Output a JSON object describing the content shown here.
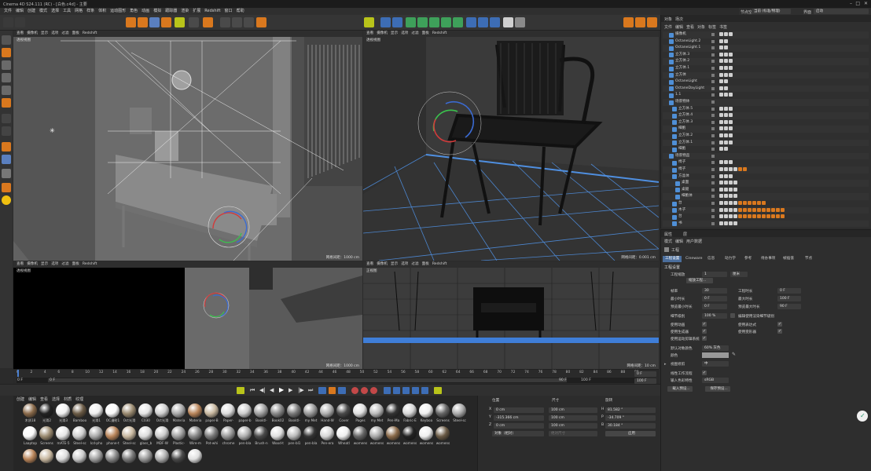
{
  "window": {
    "title": "Cinema 4D S24.111 (RC) - [白色.c4d] - 主要"
  },
  "menu": [
    "文件",
    "编辑",
    "创建",
    "模式",
    "选择",
    "工具",
    "网格",
    "样条",
    "体积",
    "运动图形",
    "角色",
    "动画",
    "模拟",
    "跟踪器",
    "渲染",
    "扩展",
    "Redshift",
    "窗口",
    "帮助"
  ],
  "viewports": {
    "menu_items": [
      "查看",
      "摄像机",
      "显示",
      "选项",
      "过滤",
      "面板",
      "Redshift"
    ],
    "tl": {
      "label": "透视视图",
      "grid": "网格间距：1000 cm"
    },
    "tr": {
      "label": "透视视图",
      "grid": "网格间距：0.001 cm"
    },
    "bl": {
      "label": "透视视图",
      "grid": "网格间距：1000 cm"
    },
    "br": {
      "label": "正视图",
      "grid": "网格间距：10 cm"
    }
  },
  "timeline": {
    "ticks": [
      "0",
      "2",
      "4",
      "6",
      "8",
      "10",
      "12",
      "14",
      "16",
      "18",
      "20",
      "22",
      "24",
      "26",
      "28",
      "30",
      "32",
      "34",
      "36",
      "38",
      "40",
      "42",
      "44",
      "46",
      "48",
      "50",
      "52",
      "54",
      "56",
      "58",
      "60",
      "62",
      "64",
      "66",
      "68",
      "70",
      "72",
      "74",
      "76",
      "78",
      "80",
      "82",
      "84",
      "86",
      "88",
      "90"
    ],
    "current": "0 F",
    "start": "0 F",
    "end": "90 F",
    "end2": "100 F",
    "right_a": "0 F",
    "right_b": "100 F"
  },
  "materials": {
    "menu": [
      "创建",
      "编辑",
      "查看",
      "选择",
      "材质",
      "纹理"
    ],
    "row1": [
      "木质18",
      "光滑2",
      "光滑3",
      "Bamboo",
      "光滑1",
      "OC漫射1",
      "Oct光滑",
      "C030",
      "Oct光滑",
      "Materia",
      "Materia",
      "paper-B",
      "Paper-",
      "paper-b",
      "Booktl-",
      "Book02",
      "Booktl-",
      "my Met",
      "Hand-W",
      "Cover",
      "Pages",
      "my Met",
      "Pen-Ma",
      "Fabric-E",
      "Keyboa",
      "Screens",
      "Steel-sc"
    ],
    "row2": [
      "Laaptop",
      "Screens",
      "mATE-5",
      "Steel-sc",
      "Icd-pho",
      "phone-t",
      "Steel-sc",
      "glass_b",
      "MDF-W",
      "Plastic-",
      "Wire-m",
      "Pot-whi",
      "chrome",
      "pen-bla",
      "Brush-n",
      "Wood-t",
      "pen-bl1",
      "pen-bla",
      "Pen-era",
      "Wheatl",
      "womens",
      "womens",
      "womens",
      "womens",
      "womens",
      "womens"
    ],
    "row3": [
      "",
      "",
      "",
      "",
      "",
      "",
      "",
      "",
      "",
      "",
      ""
    ]
  },
  "coords": {
    "headers": [
      "位置",
      "尺寸",
      "旋转"
    ],
    "x": {
      "label": "X",
      "pos": "0 cm",
      "size": "100 cm",
      "rot_label": "H",
      "rot": "81.582 °"
    },
    "y": {
      "label": "Y",
      "pos": "-315.366 cm",
      "size": "100 cm",
      "rot_label": "P",
      "rot": "-34.709 °"
    },
    "z": {
      "label": "Z",
      "pos": "0 cm",
      "size": "100 cm",
      "rot_label": "B",
      "rot": "30.184 °"
    },
    "mode": "对象（相对）",
    "size_mode": "绝对尺寸",
    "apply": "应用"
  },
  "objects": {
    "tabs": [
      "对象",
      "场次"
    ],
    "menu": [
      "文件",
      "编辑",
      "查看",
      "对象",
      "标签",
      "书签"
    ],
    "top_right": {
      "node_space": "节点空间",
      "node_value": "当前 (标准/物理)",
      "layout_label": "界面",
      "layout_value": "启动"
    },
    "items": [
      "摄像机",
      "OctaneLight.2",
      "OctaneLight.1",
      "立方体.3",
      "立方体.2",
      "立方体.1",
      "立方体",
      "OctaneLight",
      "OctaneDayLight",
      "1.1",
      "场景物体",
      "立方体.5",
      "立方体.4",
      "立方体.3",
      "细胞",
      "立方体.2",
      "立方体.1",
      "细胞",
      "场景物品",
      "椅子",
      "椅子",
      "方晶体",
      "桌面",
      "桌腿",
      "细胞体",
      "台",
      "木子",
      "台",
      "书"
    ]
  },
  "attributes": {
    "tabs": [
      "属性",
      "层"
    ],
    "menu": [
      "模式",
      "编辑",
      "用户数据"
    ],
    "title": "工程",
    "subtabs": [
      "工程设置",
      "Cineware",
      "信息",
      "动力学",
      "参考",
      "待办事项",
      "帧插值",
      "节点"
    ],
    "section": "工程设置",
    "scale_label": "工程缩放",
    "scale_value": "1",
    "scale_unit": "厘米",
    "scale_btn": "缩放工程...",
    "fps_label": "帧率",
    "fps_value": "30",
    "project_time_label": "工程时长",
    "project_time_value": "0 F",
    "min_time_label": "最小时长",
    "min_time_value": "0 F",
    "max_time_label": "最大时长",
    "max_time_value": "100 F",
    "preview_min_label": "预览最小时长",
    "preview_min_value": "0 F",
    "preview_max_label": "预览最大时长",
    "preview_max_value": "90 F",
    "lod_label": "细节级别",
    "lod_value": "100 %",
    "lod_render_label": "编辑使用渲染细节级别",
    "use_anim_label": "使用动画",
    "use_expr_label": "使用表达式",
    "use_gen_label": "使用生成器",
    "use_deform_label": "使用变形器",
    "use_motion_label": "使用运动剪辑系统",
    "def_color_label": "默认对象颜色",
    "def_color_value": "60% 灰色",
    "color_label": "颜色",
    "view_clip_label": "视图修剪",
    "view_clip_value": "中",
    "linear_label": "线性工作流程",
    "input_profile_label": "输入色彩特性",
    "input_profile_value": "sRGB",
    "load_preset": "载入预设...",
    "save_preset": "保存预设..."
  }
}
